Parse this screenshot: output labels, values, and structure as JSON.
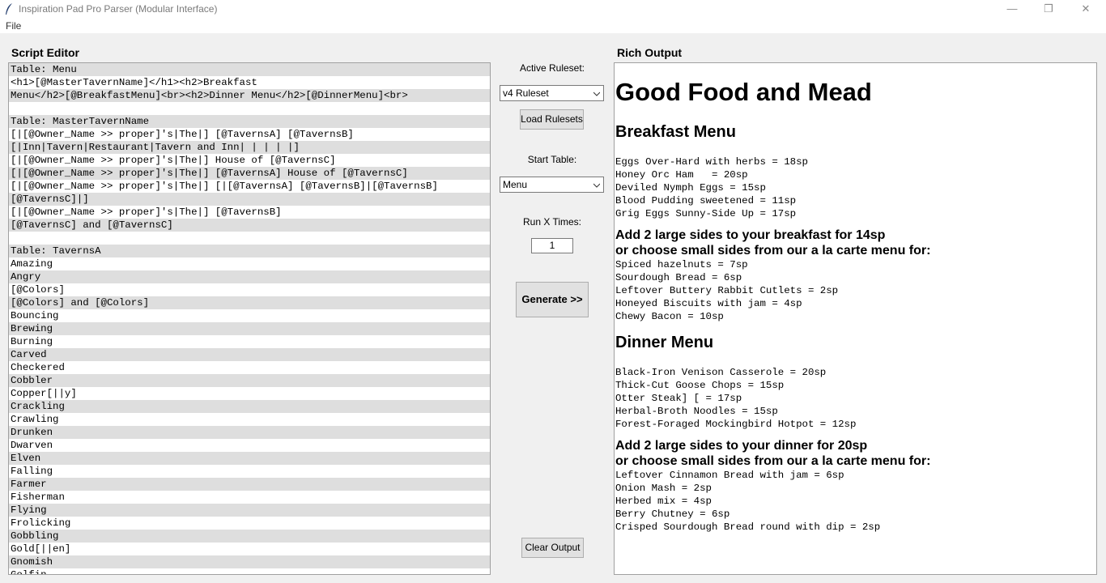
{
  "window": {
    "title": "Inspiration Pad Pro Parser (Modular Interface)",
    "controls": {
      "minimize": "—",
      "restore": "❐",
      "close": "✕"
    }
  },
  "menu": {
    "file": "File"
  },
  "editor": {
    "title": "Script Editor",
    "lines": [
      "Table: Menu",
      "<h1>[@MasterTavernName]</h1><h2>Breakfast",
      "Menu</h2>[@BreakfastMenu]<br><h2>Dinner Menu</h2>[@DinnerMenu]<br>",
      "",
      "Table: MasterTavernName",
      "[|[@Owner_Name >> proper]'s|The|] [@TavernsA] [@TavernsB]",
      "[|Inn|Tavern|Restaurant|Tavern and Inn| | | | |]",
      "[|[@Owner_Name >> proper]'s|The|] House of [@TavernsC]",
      "[|[@Owner_Name >> proper]'s|The|] [@TavernsA] House of [@TavernsC]",
      "[|[@Owner_Name >> proper]'s|The|] [|[@TavernsA] [@TavernsB]|[@TavernsB]",
      "[@TavernsC]|]",
      "[|[@Owner_Name >> proper]'s|The|] [@TavernsB]",
      "[@TavernsC] and [@TavernsC]",
      "",
      "Table: TavernsA",
      "Amazing",
      "Angry",
      "[@Colors]",
      "[@Colors] and [@Colors]",
      "Bouncing",
      "Brewing",
      "Burning",
      "Carved",
      "Checkered",
      "Cobbler",
      "Copper[||y]",
      "Crackling",
      "Crawling",
      "Drunken",
      "Dwarven",
      "Elven",
      "Falling",
      "Farmer",
      "Fisherman",
      "Flying",
      "Frolicking",
      "Gobbling",
      "Gold[||en]",
      "Gnomish",
      "Golfin"
    ]
  },
  "controls": {
    "active_ruleset_label": "Active Ruleset:",
    "ruleset_value": "v4 Ruleset",
    "load_rulesets": "Load Rulesets",
    "start_table_label": "Start Table:",
    "start_table_value": "Menu",
    "run_x_label": "Run X Times:",
    "run_x_value": "1",
    "generate": "Generate >>",
    "clear_output": "Clear Output"
  },
  "output": {
    "title": "Rich Output",
    "heading": "Good Food and Mead",
    "breakfast_heading": "Breakfast Menu",
    "breakfast_items": [
      "Eggs Over-Hard with herbs = 18sp",
      "Honey Orc Ham   = 20sp",
      "Deviled Nymph Eggs = 15sp",
      "Blood Pudding sweetened = 11sp",
      "Grig Eggs Sunny-Side Up = 17sp"
    ],
    "breakfast_sides_1": "Add 2 large sides to your breakfast for 14sp",
    "breakfast_sides_2": "or choose small sides from our a la carte menu for:",
    "breakfast_sides_items": [
      "Spiced hazelnuts = 7sp",
      "Sourdough Bread = 6sp",
      "Leftover Buttery Rabbit Cutlets = 2sp",
      "Honeyed Biscuits with jam = 4sp",
      "Chewy Bacon = 10sp"
    ],
    "dinner_heading": "Dinner Menu",
    "dinner_items": [
      "Black-Iron Venison Casserole = 20sp",
      "Thick-Cut Goose Chops = 15sp",
      "Otter Steak] [ = 17sp",
      "Herbal-Broth Noodles = 15sp",
      "Forest-Foraged Mockingbird Hotpot = 12sp"
    ],
    "dinner_sides_1": "Add 2 large sides to your dinner for 20sp",
    "dinner_sides_2": "or choose small sides from our a la carte menu for:",
    "dinner_sides_items": [
      "Leftover Cinnamon Bread with jam = 6sp",
      "Onion Mash = 2sp",
      "Herbed mix = 4sp",
      "Berry Chutney = 6sp",
      "Crisped Sourdough Bread round with dip = 2sp"
    ]
  }
}
